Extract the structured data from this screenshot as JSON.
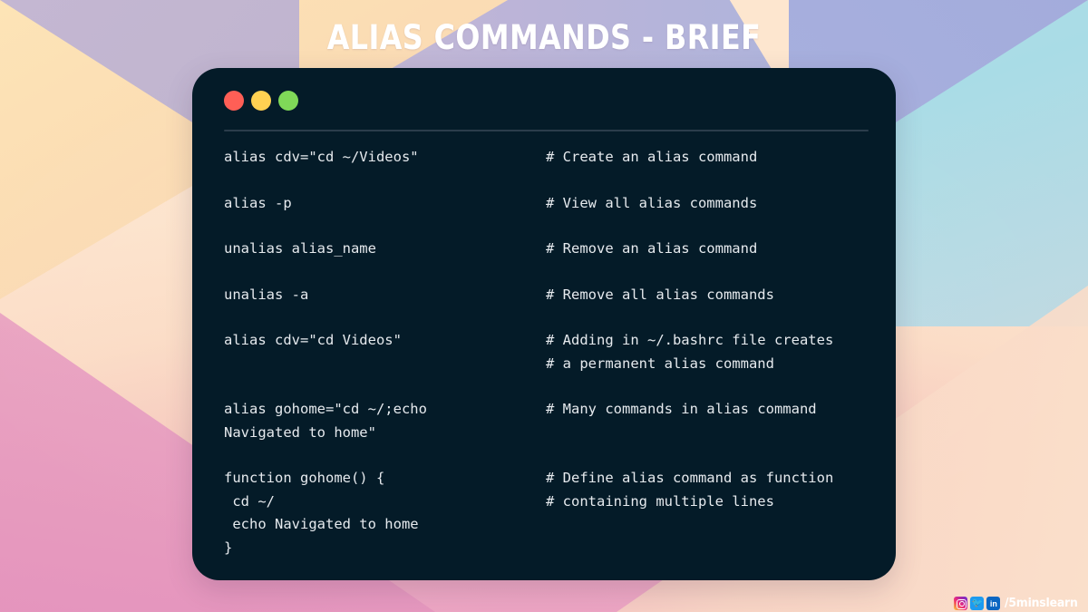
{
  "title": "ALIAS COMMANDS - BRIEF",
  "background": {
    "colors": {
      "peach": "#fde3b4",
      "lavender": "#bfb4ce",
      "periwinkle": "#a3acdc",
      "cyan": "#aee0e8",
      "pink": "#e490bd",
      "soft_peach": "#fad9c8"
    }
  },
  "terminal": {
    "background_color": "#041b28",
    "text_color": "#e6eaee",
    "dots": [
      {
        "name": "close-dot",
        "color": "#ff5f56"
      },
      {
        "name": "minimize-dot",
        "color": "#ffd152"
      },
      {
        "name": "maximize-dot",
        "color": "#7fd858"
      }
    ],
    "rows": [
      {
        "command": [
          "alias cdv=\"cd ~/Videos\""
        ],
        "comment": [
          "# Create an alias command"
        ]
      },
      {
        "command": [
          "alias -p"
        ],
        "comment": [
          "# View all alias commands"
        ]
      },
      {
        "command": [
          "unalias alias_name"
        ],
        "comment": [
          "# Remove an alias command"
        ]
      },
      {
        "command": [
          "unalias -a"
        ],
        "comment": [
          "# Remove all alias commands"
        ]
      },
      {
        "command": [
          "alias cdv=\"cd Videos\""
        ],
        "comment": [
          "# Adding in ~/.bashrc file creates",
          "# a permanent alias command"
        ]
      },
      {
        "command": [
          "alias gohome=\"cd ~/;echo",
          "Navigated to home\""
        ],
        "comment": [
          "# Many commands in alias command"
        ]
      },
      {
        "command": [
          "function gohome() {",
          " cd ~/",
          " echo Navigated to home",
          "}"
        ],
        "comment": [
          "# Define alias command as function",
          "# containing multiple lines"
        ]
      }
    ]
  },
  "watermark": {
    "handle": "/5minslearn",
    "icons": [
      "instagram-icon",
      "twitter-icon",
      "linkedin-icon"
    ]
  }
}
